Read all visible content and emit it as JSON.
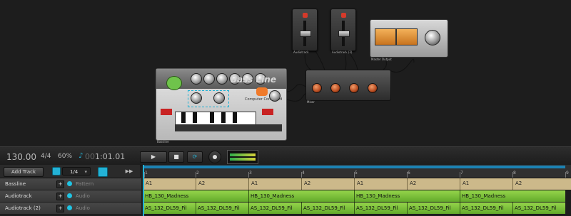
{
  "rack": {
    "bassline_title": "Bass Line",
    "bassline_brand": "Computer Controlled",
    "bassline_label": "Bassline",
    "device_labels": [
      "Audiotrack",
      "Audiotrack (2)",
      "Master Output",
      "Mixer"
    ]
  },
  "transport": {
    "tempo": "130.00",
    "signature": "4/4",
    "swing": "60%",
    "position_dim": "00",
    "position": "1:01.01",
    "play_icon": "play-icon",
    "stop_icon": "stop-icon",
    "loop_icon": "loop-icon",
    "record_icon": "record-icon"
  },
  "header": {
    "add_track_label": "Add Track",
    "quantize_value": "1/4"
  },
  "ruler": {
    "bars": [
      "1",
      "2",
      "3",
      "4",
      "5",
      "6",
      "7",
      "8",
      "9"
    ]
  },
  "tracks": [
    {
      "name": "Bassline",
      "type": "Pattern"
    },
    {
      "name": "Audiotrack",
      "type": "Audio"
    },
    {
      "name": "Audiotrack (2)",
      "type": "Audio"
    }
  ],
  "clips": {
    "pattern": [
      "A1",
      "A2",
      "A1",
      "A2",
      "A1",
      "A2",
      "A1",
      "A2"
    ],
    "audio1": [
      "HB_130_Madness",
      "HB_130_Madness",
      "HB_130_Madness",
      "HB_130_Madness"
    ],
    "audio2": [
      "AS_132_DL59_Fil",
      "AS_132_DL59_Fil",
      "AS_132_DL59_Fil",
      "AS_132_DL59_Fil",
      "AS_132_DL59_Fil",
      "AS_132_DL59_Fil",
      "AS_132_DL59_Fil",
      "AS_132_DL59_Fil"
    ]
  },
  "colors": {
    "accent": "#23b2d6",
    "pattern_clip": "#ccb98a",
    "audio_clip": "#8ed14b"
  }
}
